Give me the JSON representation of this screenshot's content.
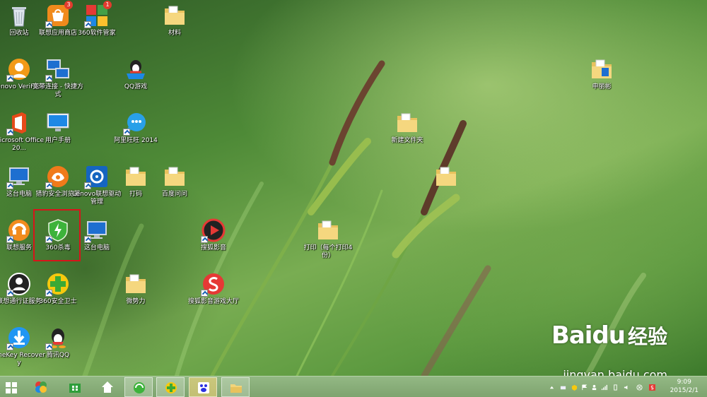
{
  "desktop": {
    "icons": [
      {
        "id": "recycle",
        "label": "回收站",
        "icon": "recycle-bin-icon"
      },
      {
        "id": "lenovo-store",
        "label": "联想应用商店",
        "icon": "lenovo-store-icon",
        "badge": "3"
      },
      {
        "id": "soft360",
        "label": "360软件管家",
        "icon": "360-software-icon",
        "badge": "1"
      },
      {
        "id": "materials",
        "label": "材料",
        "icon": "folder-icon"
      },
      {
        "id": "veriface",
        "label": "Lenovo VeriFace",
        "icon": "veriface-icon"
      },
      {
        "id": "broadband",
        "label": "宽带连接 - 快捷方式",
        "icon": "network-connection-icon"
      },
      {
        "id": "qqgame",
        "label": "QQ游戏",
        "icon": "qq-game-icon"
      },
      {
        "id": "office",
        "label": "Microsoft Office 20...",
        "icon": "office-icon"
      },
      {
        "id": "manual",
        "label": "用户手册",
        "icon": "user-manual-icon"
      },
      {
        "id": "aliwangwang",
        "label": "阿里旺旺 2014",
        "icon": "aliwangwang-icon"
      },
      {
        "id": "thispc1",
        "label": "这台电脑",
        "icon": "computer-icon"
      },
      {
        "id": "liebao",
        "label": "猎豹安全浏览器",
        "icon": "liebao-browser-icon"
      },
      {
        "id": "driver",
        "label": "Lenovo联想驱动管理",
        "icon": "driver-manager-icon"
      },
      {
        "id": "print",
        "label": "打码",
        "icon": "folder-icon"
      },
      {
        "id": "baidu-ask",
        "label": "百度问问",
        "icon": "folder-icon"
      },
      {
        "id": "lenovo-service",
        "label": "联想服务",
        "icon": "lenovo-service-icon"
      },
      {
        "id": "av360",
        "label": "360杀毒",
        "icon": "360-antivirus-icon"
      },
      {
        "id": "thispc2",
        "label": "这台电脑",
        "icon": "computer-icon"
      },
      {
        "id": "sohu-player",
        "label": "搜狐影音",
        "icon": "sohu-player-icon"
      },
      {
        "id": "lenovo-id",
        "label": "联想通行证服务",
        "icon": "lenovo-id-icon"
      },
      {
        "id": "safe360",
        "label": "360安全卫士",
        "icon": "360-safeguard-icon"
      },
      {
        "id": "weishili",
        "label": "微势力",
        "icon": "folder-icon"
      },
      {
        "id": "sohu-game",
        "label": "搜狐影音游戏大厅",
        "icon": "sohu-game-icon"
      },
      {
        "id": "onekey",
        "label": "OneKey Recovery",
        "icon": "onekey-recovery-icon"
      },
      {
        "id": "qq",
        "label": "腾讯QQ",
        "icon": "qq-icon"
      },
      {
        "id": "newfolder",
        "label": "新建文件夹",
        "icon": "folder-icon"
      },
      {
        "id": "print4",
        "label": "打印（每个打印4份）",
        "icon": "folder-icon"
      },
      {
        "id": "shenlilin",
        "label": "申丽彬",
        "icon": "folder-icon"
      },
      {
        "id": "folder-mid",
        "label": "",
        "icon": "folder-icon"
      }
    ],
    "watermark": {
      "logo": "Baidu",
      "cn": "经验",
      "url": "jingyan.baidu.com"
    }
  },
  "taskbar": {
    "start": "windows-logo-icon",
    "apps": [
      {
        "id": "colors",
        "icon": "color-app-icon"
      },
      {
        "id": "store",
        "icon": "windows-store-icon"
      },
      {
        "id": "home",
        "icon": "home-icon"
      },
      {
        "id": "ie360",
        "icon": "360-browser-icon"
      },
      {
        "id": "safe360",
        "icon": "360-safeguard-icon"
      },
      {
        "id": "baidu",
        "icon": "baidu-icon"
      },
      {
        "id": "explorer",
        "icon": "file-explorer-icon"
      }
    ],
    "clock": {
      "time": "9:09",
      "date": "2015/2/1"
    }
  },
  "colors": {
    "highlight": "#d8141b",
    "taskbar": "#88ad79",
    "folder": "#f2d47a"
  }
}
